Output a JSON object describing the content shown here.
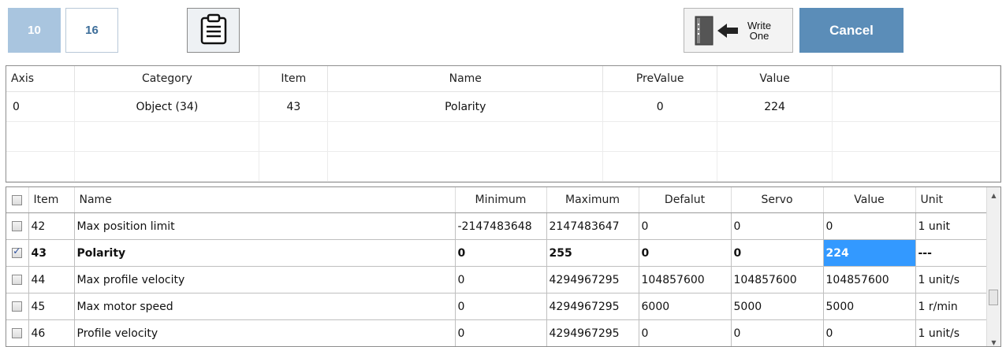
{
  "toolbar": {
    "dec_label": "10",
    "hex_label": "16",
    "clipboard_icon": "clipboard-icon",
    "write_label_line1": "Write",
    "write_label_line2": "One",
    "write_icon": "write-one-icon",
    "cancel_label": "Cancel"
  },
  "upper_grid": {
    "columns": [
      "Axis",
      "Category",
      "Item",
      "Name",
      "PreValue",
      "Value",
      ""
    ],
    "rows": [
      [
        "0",
        "Object (34)",
        "43",
        "Polarity",
        "0",
        "224",
        ""
      ],
      [
        "",
        "",
        "",
        "",
        "",
        "",
        ""
      ],
      [
        "",
        "",
        "",
        "",
        "",
        "",
        ""
      ]
    ]
  },
  "lower_grid": {
    "columns": [
      "",
      "Item",
      "Name",
      "Minimum",
      "Maximum",
      "Defalut",
      "Servo",
      "Value",
      "Unit"
    ],
    "rows": [
      {
        "checked": false,
        "item": "42",
        "name": "Max position limit",
        "min": "-2147483648",
        "max": "2147483647",
        "default": "0",
        "servo": "0",
        "value": "0",
        "unit": "1 unit"
      },
      {
        "checked": true,
        "item": "43",
        "name": "Polarity",
        "min": "0",
        "max": "255",
        "default": "0",
        "servo": "0",
        "value": "224",
        "unit": "---"
      },
      {
        "checked": false,
        "item": "44",
        "name": "Max profile velocity",
        "min": "0",
        "max": "4294967295",
        "default": "104857600",
        "servo": "104857600",
        "value": "104857600",
        "unit": "1 unit/s"
      },
      {
        "checked": false,
        "item": "45",
        "name": "Max motor speed",
        "min": "0",
        "max": "4294967295",
        "default": "6000",
        "servo": "5000",
        "value": "5000",
        "unit": "1 r/min"
      },
      {
        "checked": false,
        "item": "46",
        "name": "Profile velocity",
        "min": "0",
        "max": "4294967295",
        "default": "0",
        "servo": "0",
        "value": "0",
        "unit": "1 unit/s"
      }
    ]
  },
  "colors": {
    "accent": "#5b8db8",
    "selection": "#3399ff",
    "dec_button": "#a9c5df"
  }
}
